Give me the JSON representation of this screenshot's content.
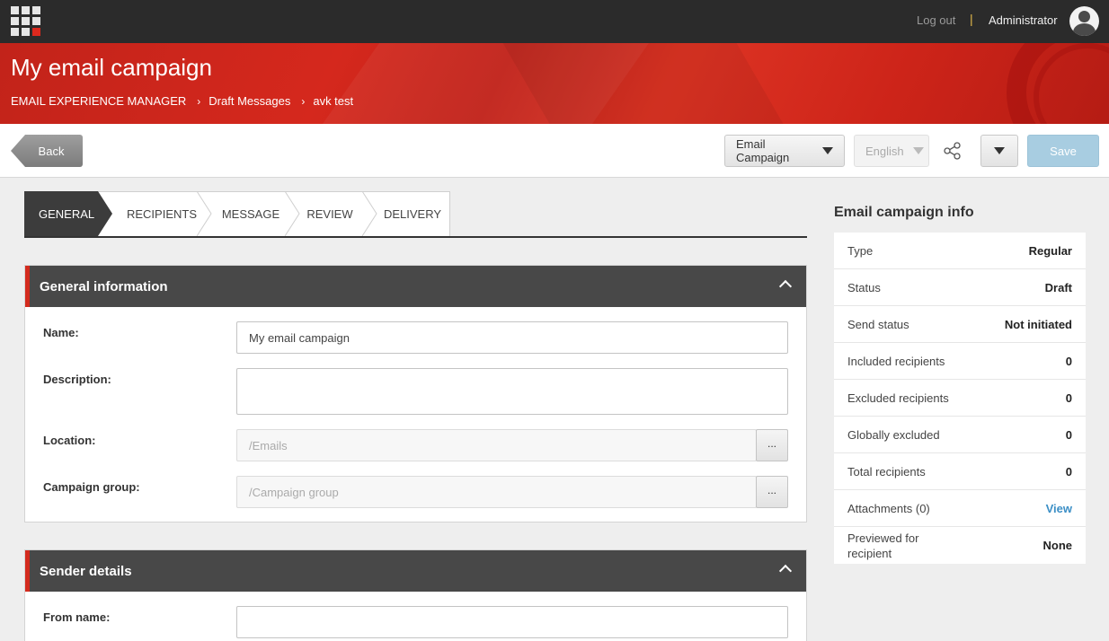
{
  "topbar": {
    "logout_label": "Log out",
    "separator": "|",
    "username": "Administrator"
  },
  "header": {
    "title": "My email campaign",
    "breadcrumbs": [
      "EMAIL EXPERIENCE MANAGER",
      "Draft Messages",
      "avk test"
    ]
  },
  "toolbar": {
    "back_label": "Back",
    "campaign_type_dropdown": "Email Campaign",
    "language_dropdown": "English",
    "save_label": "Save"
  },
  "steps": [
    "GENERAL",
    "RECIPIENTS",
    "MESSAGE",
    "REVIEW",
    "DELIVERY"
  ],
  "general_info": {
    "heading": "General information",
    "name_label": "Name:",
    "name_value": "My email campaign",
    "description_label": "Description:",
    "description_value": "",
    "location_label": "Location:",
    "location_value": "/Emails",
    "campaign_group_label": "Campaign group:",
    "campaign_group_value": "/Campaign group",
    "browse_label": "..."
  },
  "sender_details": {
    "heading": "Sender details",
    "from_name_label": "From name:",
    "from_name_value": ""
  },
  "campaign_info": {
    "title": "Email campaign info",
    "rows": [
      {
        "key": "Type",
        "value": "Regular"
      },
      {
        "key": "Status",
        "value": "Draft"
      },
      {
        "key": "Send status",
        "value": "Not initiated"
      },
      {
        "key": "Included recipients",
        "value": "0"
      },
      {
        "key": "Excluded recipients",
        "value": "0"
      },
      {
        "key": "Globally excluded",
        "value": "0"
      },
      {
        "key": "Total recipients",
        "value": "0"
      },
      {
        "key": "Attachments (0)",
        "value": "View"
      },
      {
        "key": "Previewed for recipient",
        "value": "None"
      }
    ]
  },
  "colors": {
    "brand_red": "#d32b1e",
    "dark_bar": "#2b2b2b",
    "link_blue": "#3c8fc6",
    "save_disabled": "#a8cde1"
  }
}
